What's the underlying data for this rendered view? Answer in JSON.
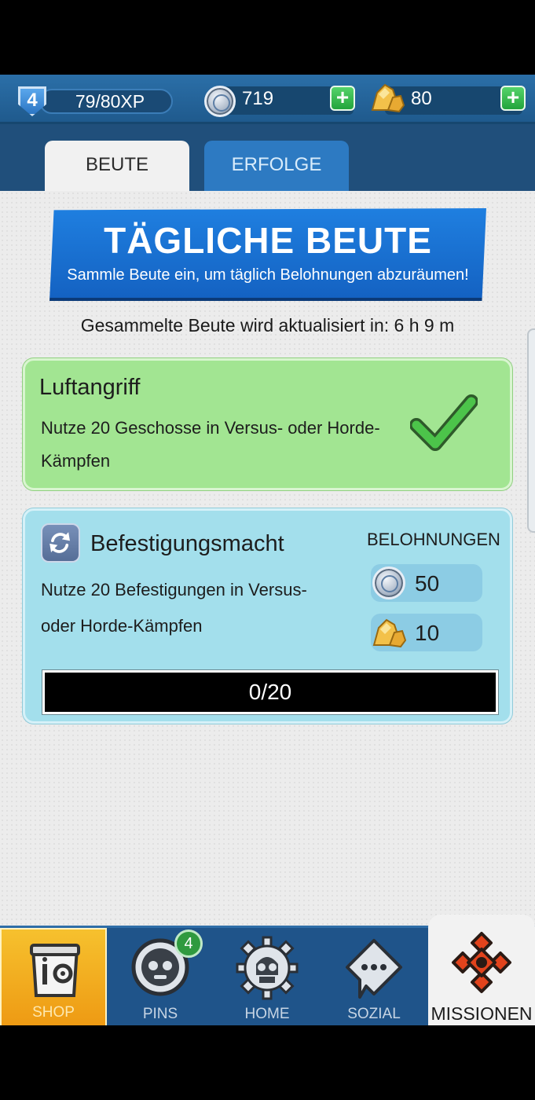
{
  "topbar": {
    "level": "4",
    "xp": "79/80XP",
    "silver": "719",
    "gold": "80",
    "plus_symbol": "+"
  },
  "tabs": [
    {
      "label": "BEUTE",
      "active": true
    },
    {
      "label": "ERFOLGE",
      "active": false
    }
  ],
  "banner": {
    "title": "TÄGLICHE BEUTE",
    "subtitle": "Sammle Beute ein, um täglich Belohnungen abzuräumen!"
  },
  "timer_text": "Gesammelte Beute wird aktualisiert in: 6 h 9 m",
  "missions": [
    {
      "title": "Luftangriff",
      "description_line1": "Nutze 20 Geschosse in Versus- oder Horde-",
      "description_line2": "Kämpfen",
      "completed": true
    },
    {
      "title": "Befestigungsmacht",
      "description_line1": "Nutze 20 Befestigungen in Versus-",
      "description_line2": "oder Horde-Kämpfen",
      "rewards_label": "BELOHNUNGEN",
      "reward_silver": "50",
      "reward_gold": "10",
      "progress_text": "0/20",
      "progress": 0
    }
  ],
  "bottom_nav": {
    "shop": "SHOP",
    "pins": "PINS",
    "pins_badge": "4",
    "home": "HOME",
    "sozial": "SOZIAL",
    "missionen": "MISSIONEN"
  },
  "colors": {
    "accent_blue": "#1f7fe0",
    "completed_card": "#a2e592",
    "active_card": "#a3dfec",
    "shop_tab": "#f6c12e",
    "plus_green": "#22a43c"
  }
}
